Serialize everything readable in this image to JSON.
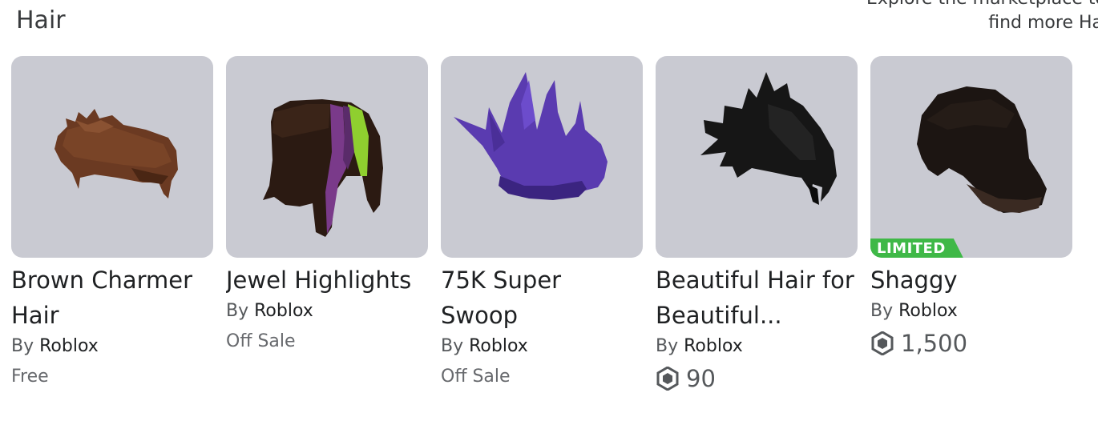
{
  "section": {
    "title": "Hair",
    "explore_text_line1": "Explore the marketplace to",
    "explore_text_line2": "find more Ha"
  },
  "items": [
    {
      "name": "Brown Charmer Hair",
      "by": "By",
      "creator": "Roblox",
      "price": "Free",
      "price_type": "text",
      "limited": false
    },
    {
      "name": "Jewel Highlights",
      "by": "By",
      "creator": "Roblox",
      "price": "Off Sale",
      "price_type": "text",
      "limited": false
    },
    {
      "name": "75K Super Swoop",
      "by": "By",
      "creator": "Roblox",
      "price": "Off Sale",
      "price_type": "text",
      "limited": false
    },
    {
      "name": "Beautiful Hair for Beautiful...",
      "by": "By",
      "creator": "Roblox",
      "price": "90",
      "price_type": "robux",
      "limited": false
    },
    {
      "name": "Shaggy",
      "by": "By",
      "creator": "Roblox",
      "price": "1,500",
      "price_type": "robux",
      "limited": true,
      "badge": "LIMITED"
    }
  ],
  "colors": {
    "thumb_bg": "#c9cad2",
    "limited_badge": "#3fb847"
  }
}
